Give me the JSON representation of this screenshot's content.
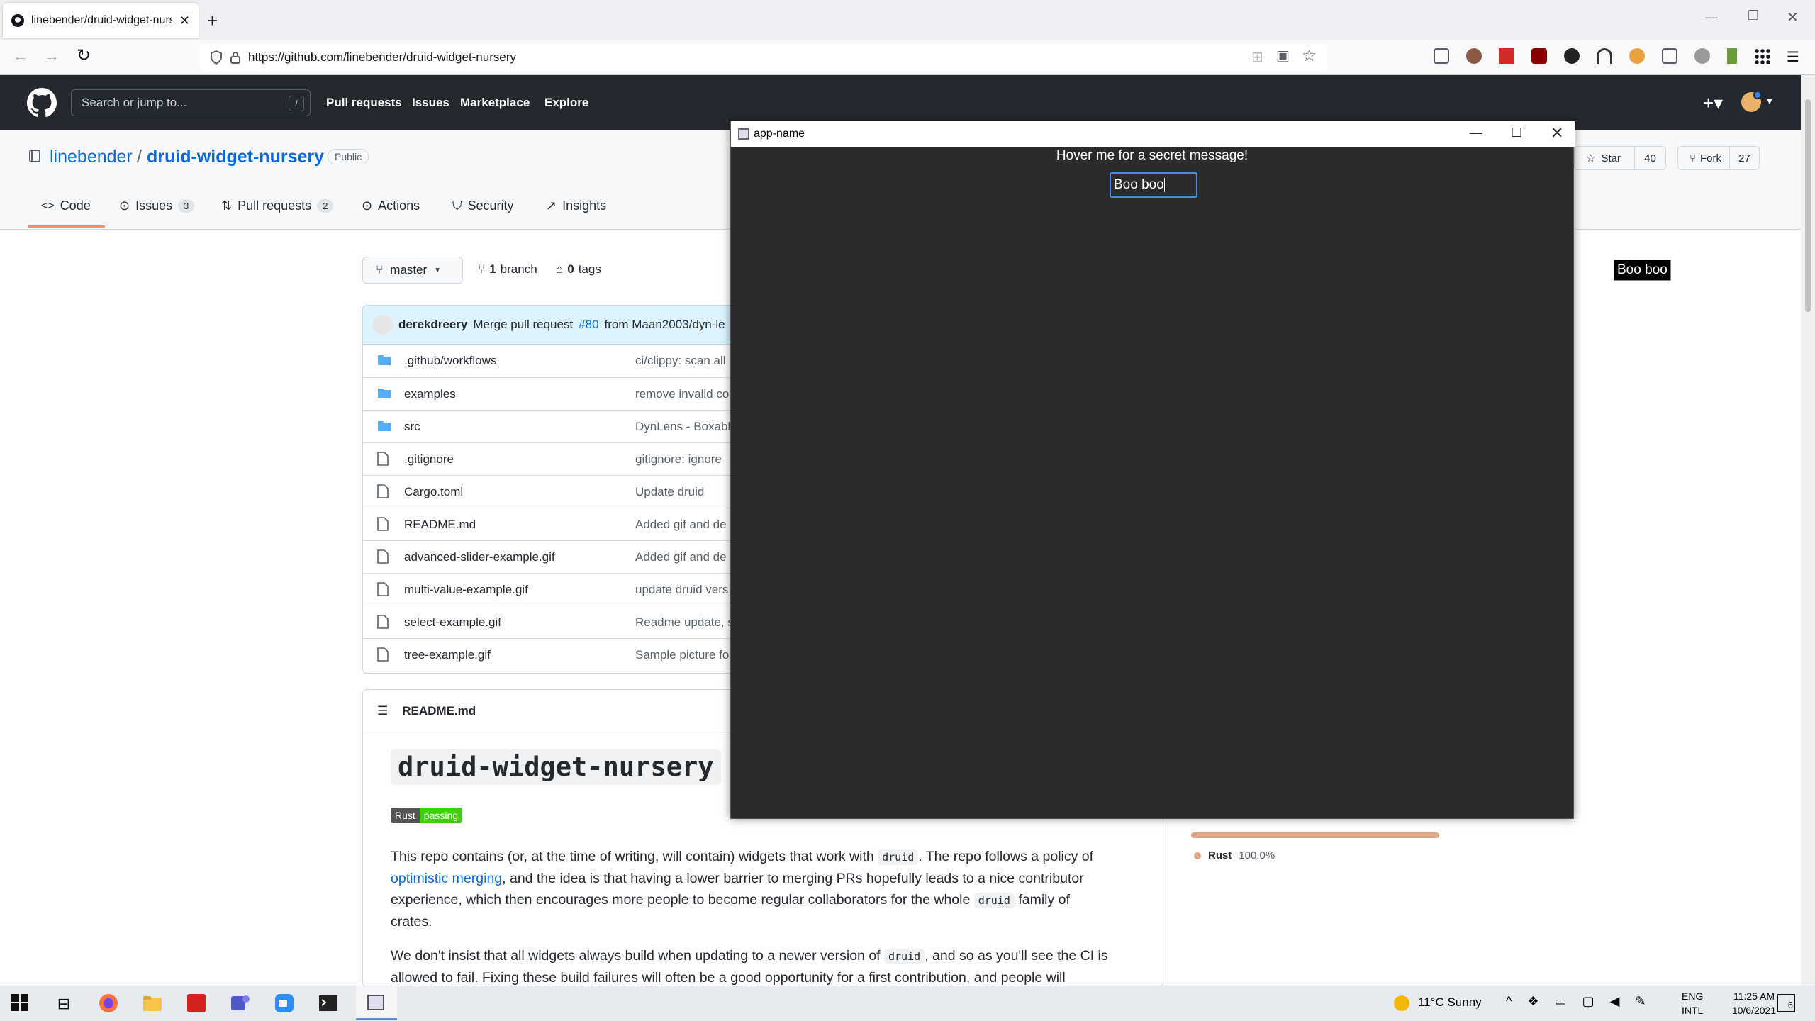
{
  "browser": {
    "tab_title": "linebender/druid-widget-nurse",
    "url": "https://github.com/linebender/druid-widget-nursery"
  },
  "github": {
    "search_placeholder": "Search or jump to...",
    "search_key": "/",
    "nav": [
      "Pull requests",
      "Issues",
      "Marketplace",
      "Explore"
    ],
    "owner": "linebender",
    "separator": "/",
    "repo": "druid-widget-nursery",
    "visibility": "Public",
    "star_label": "Star",
    "star_count": "40",
    "fork_label": "Fork",
    "fork_count": "27",
    "tabs": [
      {
        "label": "Code",
        "count": ""
      },
      {
        "label": "Issues",
        "count": "3"
      },
      {
        "label": "Pull requests",
        "count": "2"
      },
      {
        "label": "Actions",
        "count": ""
      },
      {
        "label": "Security",
        "count": ""
      },
      {
        "label": "Insights",
        "count": ""
      }
    ],
    "branch_select": "master",
    "branch_count": "1",
    "branch_word": "branch",
    "tag_count": "0",
    "tag_word": "tags",
    "commit_author": "derekdreery",
    "commit_text": "Merge pull request",
    "commit_pr": "#80",
    "commit_from": "from Maan2003/dyn-le",
    "files": [
      {
        "name": ".github/workflows",
        "type": "dir",
        "msg": "ci/clippy: scan all"
      },
      {
        "name": "examples",
        "type": "dir",
        "msg": "remove invalid co"
      },
      {
        "name": "src",
        "type": "dir",
        "msg": "DynLens - Boxabl"
      },
      {
        "name": ".gitignore",
        "type": "file",
        "msg": "gitignore: ignore"
      },
      {
        "name": "Cargo.toml",
        "type": "file",
        "msg": "Update druid"
      },
      {
        "name": "README.md",
        "type": "file",
        "msg": "Added gif and de"
      },
      {
        "name": "advanced-slider-example.gif",
        "type": "file",
        "msg": "Added gif and de"
      },
      {
        "name": "multi-value-example.gif",
        "type": "file",
        "msg": "update druid vers"
      },
      {
        "name": "select-example.gif",
        "type": "file",
        "msg": "Readme update, s"
      },
      {
        "name": "tree-example.gif",
        "type": "file",
        "msg": "Sample picture fo"
      }
    ],
    "readme_header": "README.md",
    "readme_title": "druid-widget-nursery",
    "badge_left": "Rust",
    "badge_right": "passing",
    "p1_a": "This repo contains (or, at the time of writing, will contain) widgets that work with",
    "p1_code": "druid",
    "p1_b": ". The repo follows a policy of",
    "p1_link": "optimistic merging",
    "p1_c": ", and the idea is that having a lower barrier to merging PRs hopefully leads to a nice contributor",
    "p1_d": "experience, which then encourages more people to become regular collaborators for the whole",
    "p1_code2": "druid",
    "p1_e": "family of",
    "p1_f": "crates.",
    "p2_a": "We don't insist that all widgets always build when updating to a newer version of",
    "p2_code": "druid",
    "p2_b": ", and so as you'll see the CI is",
    "p2_c": "allowed to fail. Fixing these build failures will often be a good opportunity for a first contribution, and people will",
    "lang_name": "Rust",
    "lang_pct": "100.0%",
    "lang_color": "#dea584",
    "hover_text": "Boo boo"
  },
  "app_window": {
    "title": "app-name",
    "label": "Hover me for a secret message!",
    "input_value": "Boo boo"
  },
  "taskbar": {
    "weather": "11°C  Sunny",
    "lang1": "ENG",
    "lang2": "INTL",
    "time": "11:25 AM",
    "date": "10/6/2021",
    "notif": "6"
  }
}
